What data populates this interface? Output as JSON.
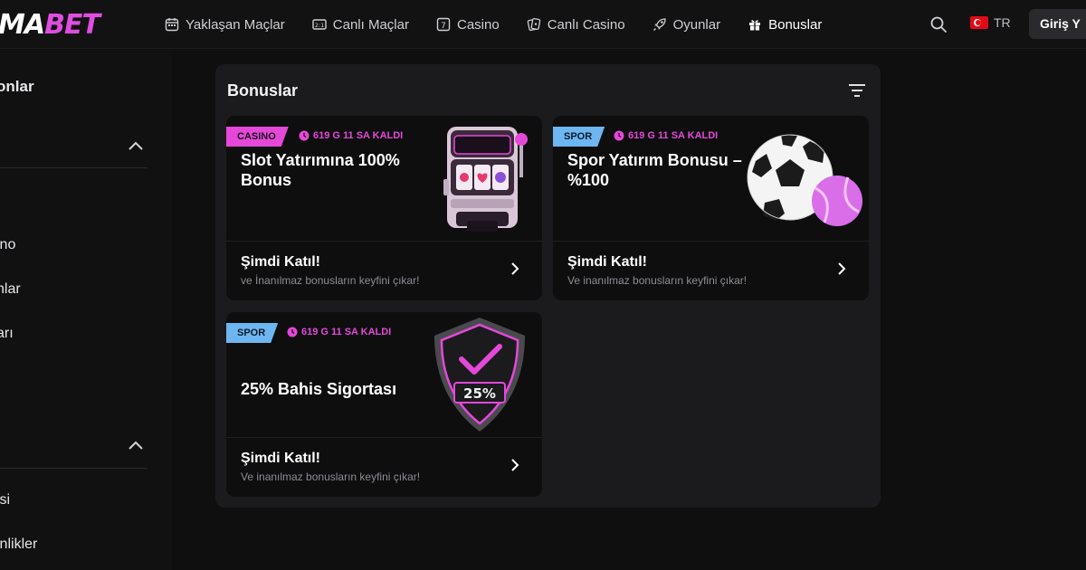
{
  "brand": {
    "logo_main": "MA",
    "logo_accent": "BET",
    "accent_color": "#e04de0"
  },
  "nav": {
    "items": [
      {
        "label": "Yaklaşan Maçlar",
        "icon": "calendar-icon"
      },
      {
        "label": "Canlı Maçlar",
        "icon": "scoreboard-icon"
      },
      {
        "label": "Casino",
        "icon": "slot-icon"
      },
      {
        "label": "Canlı Casino",
        "icon": "cards-icon"
      },
      {
        "label": "Oyunlar",
        "icon": "rocket-icon"
      },
      {
        "label": "Bonuslar",
        "icon": "gift-icon"
      }
    ],
    "language": "TR",
    "login_label": "Giriş Y"
  },
  "sidebar": {
    "heading": "onlar",
    "items": [
      "ino",
      "nlar",
      "arı",
      "isi",
      "inlikler"
    ]
  },
  "panel": {
    "title": "Bonuslar",
    "cards": [
      {
        "tag": "CASINO",
        "timer": "619 G 11 SA KALDI",
        "title": "Slot Yatırımına 100% Bonus",
        "cta": "Şimdi Katıl!",
        "sub": "ve İnanılmaz bonusların keyfini çıkar!"
      },
      {
        "tag": "SPOR",
        "timer": "619 G 11 SA KALDI",
        "title": "Spor Yatırım Bonusu – %100",
        "cta": "Şimdi Katıl!",
        "sub": "Ve inanılmaz bonusların keyfini çıkar!"
      },
      {
        "tag": "SPOR",
        "timer": "619 G 11 SA KALDI",
        "title": "25% Bahis Sigortası",
        "badge": "25%",
        "cta": "Şimdi Katıl!",
        "sub": "Ve inanılmaz bonusların keyfini çıkar!"
      }
    ]
  }
}
